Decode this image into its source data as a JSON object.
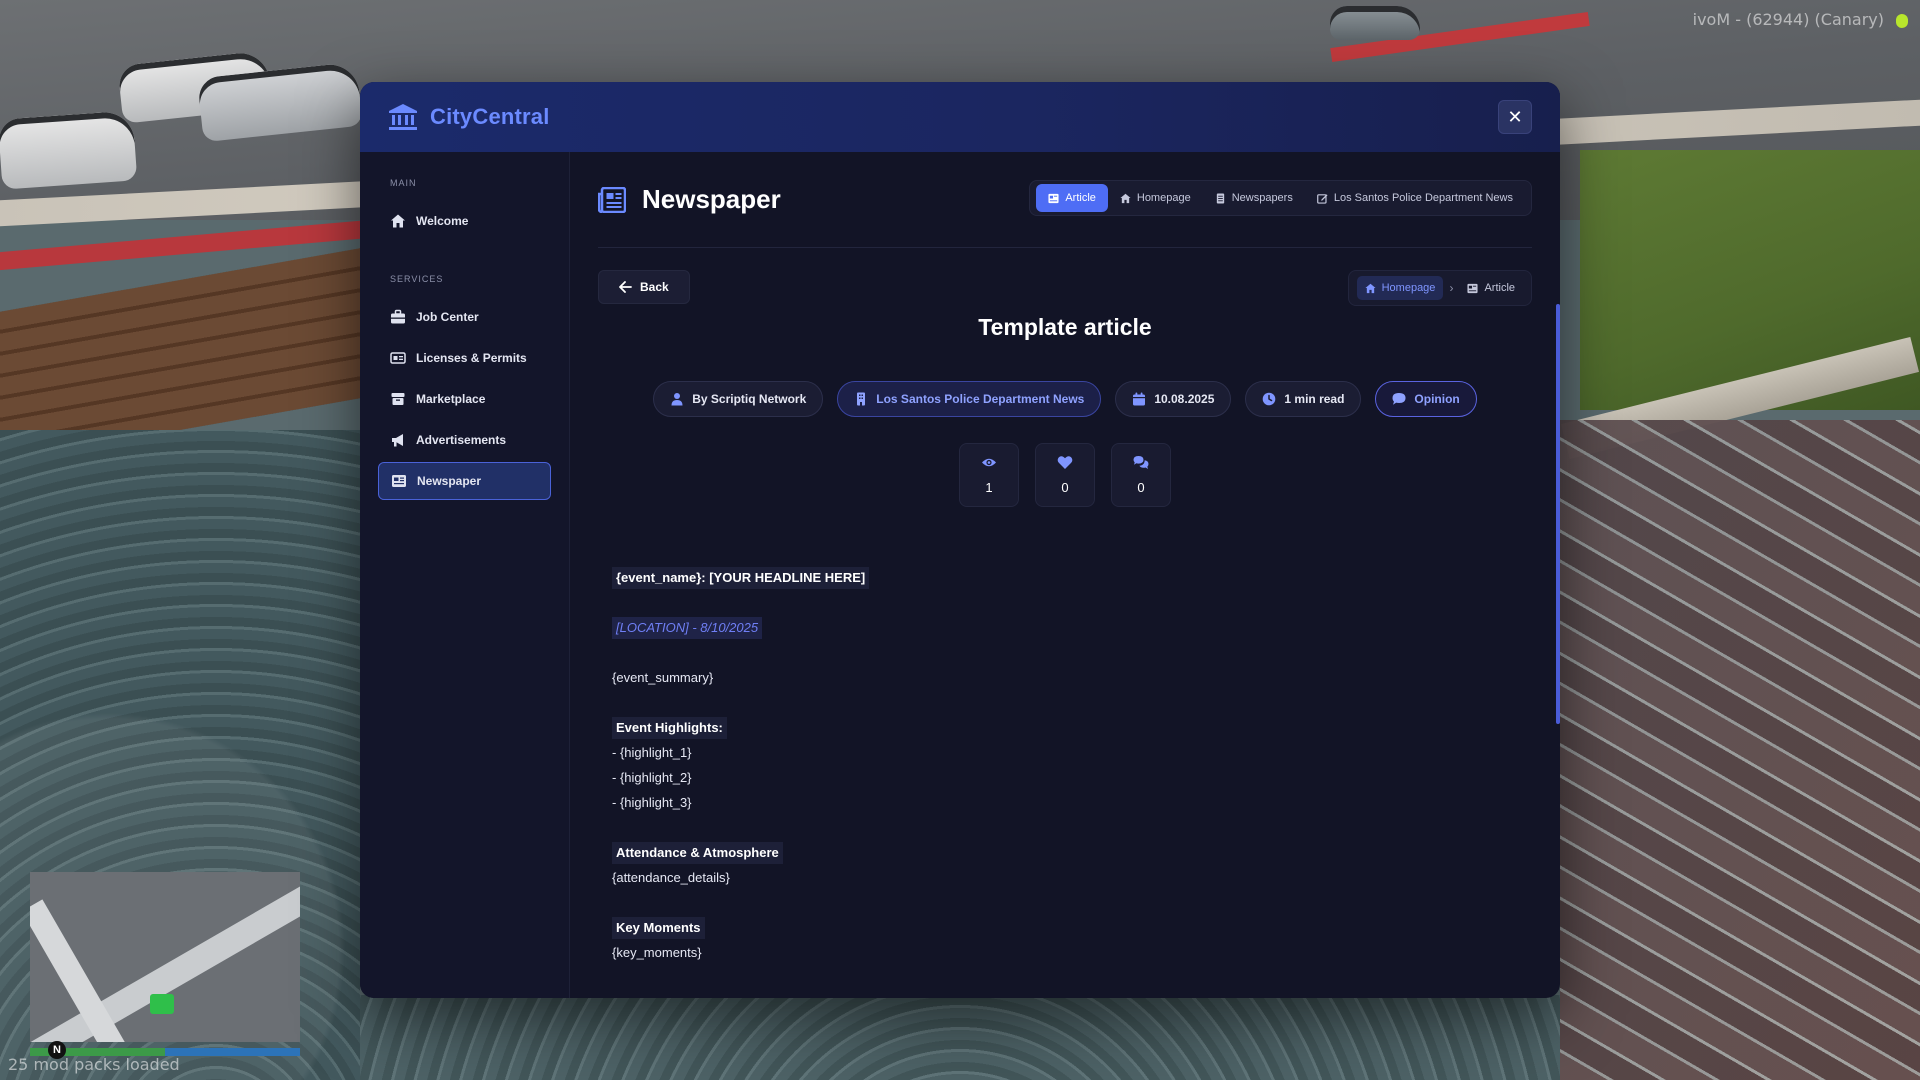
{
  "overlay": {
    "server_text": "ivoM - (62944) (Canary)",
    "mod_packs": "25 mod packs loaded",
    "compass": "N"
  },
  "app": {
    "title": "CityCentral",
    "close_icon": "x-icon",
    "accent": "#4e6df5"
  },
  "sidebar": {
    "main_label": "MAIN",
    "services_label": "SERVICES",
    "main_items": [
      {
        "label": "Welcome",
        "icon": "home-icon"
      }
    ],
    "service_items": [
      {
        "label": "Job Center",
        "icon": "briefcase-icon"
      },
      {
        "label": "Licenses & Permits",
        "icon": "id-card-icon"
      },
      {
        "label": "Marketplace",
        "icon": "box-icon"
      },
      {
        "label": "Advertisements",
        "icon": "megaphone-icon"
      },
      {
        "label": "Newspaper",
        "icon": "newspaper-icon",
        "active": true
      }
    ]
  },
  "page": {
    "title": "Newspaper",
    "tabs": [
      {
        "label": "Article",
        "icon": "newspaper-icon",
        "active": true
      },
      {
        "label": "Homepage",
        "icon": "home-icon"
      },
      {
        "label": "Newspapers",
        "icon": "document-icon"
      },
      {
        "label": "Los Santos Police Department News",
        "icon": "edit-icon"
      }
    ],
    "back_label": "Back",
    "breadcrumb": [
      {
        "label": "Homepage",
        "icon": "home-icon"
      },
      {
        "label": "Article",
        "icon": "newspaper-icon"
      }
    ]
  },
  "article": {
    "title": "Template article",
    "author": "By Scriptiq Network",
    "department": "Los Santos Police Department News",
    "date": "10.08.2025",
    "read_time": "1 min read",
    "category": "Opinion",
    "stats": {
      "views": "1",
      "likes": "0",
      "comments": "0"
    },
    "body": {
      "headline": "{event_name}: [YOUR HEADLINE HERE]",
      "location": "[LOCATION] - 8/10/2025",
      "summary": "{event_summary}",
      "highlights_heading": "Event Highlights:",
      "highlights": [
        "- {highlight_1}",
        "- {highlight_2}",
        "- {highlight_3}"
      ],
      "attendance_heading": "Attendance & Atmosphere",
      "attendance": "{attendance_details}",
      "key_heading": "Key Moments",
      "key": "{key_moments}"
    }
  }
}
